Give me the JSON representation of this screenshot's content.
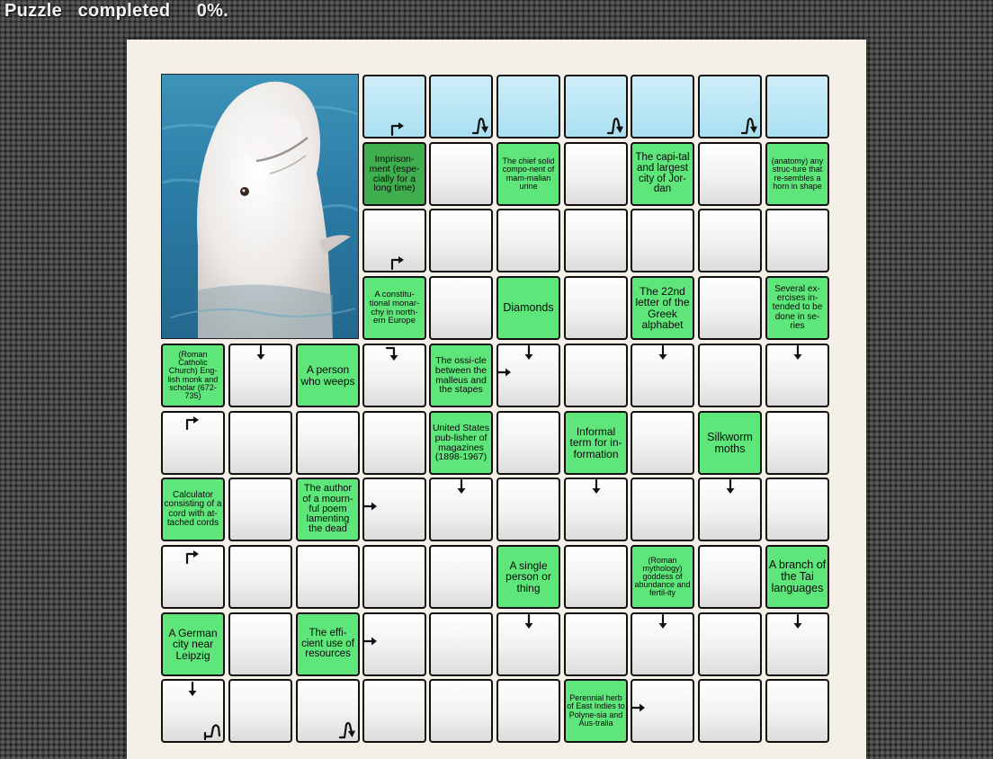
{
  "status": {
    "label": "Puzzle",
    "word": "completed",
    "percent": "0%."
  },
  "photo_icon": "beluga-whale-photo",
  "colors": {
    "clue": "#5fe67a",
    "clue_selected": "#3fae4e",
    "answer_row": "#a9dff0",
    "paper": "#f4f0e8"
  },
  "grid": {
    "answer_row": [
      {
        "arrow": "corner-right"
      },
      {
        "arrow": "snake-down"
      },
      {
        "arrow": ""
      },
      {
        "arrow": "snake-down"
      },
      {
        "arrow": ""
      },
      {
        "arrow": "snake-down"
      },
      {
        "arrow": ""
      }
    ],
    "clues": [
      {
        "text": "Imprison-ment (espe-cially for a long time)",
        "selected": true
      },
      {
        "text": "The chief solid compo-nent of mam-malian urine"
      },
      {
        "text": "The capi-tal and largest city of Jor-dan"
      },
      {
        "text": "(anatomy) any struc-ture that re-sembles a horn in shape"
      },
      {
        "text": "A constitu-tional monar-chy in north-ern Europe"
      },
      {
        "text": "Diamonds"
      },
      {
        "text": "The 22nd letter of the Greek alphabet"
      },
      {
        "text": "Several ex-ercises in-tended to be done in se-ries"
      },
      {
        "text": "(Roman Catholic Church) Eng-lish monk and scholar (672-735)"
      },
      {
        "text": "A person who weeps"
      },
      {
        "text": "The ossi-cle between the malleus and the stapes"
      },
      {
        "text": "United States pub-lisher of magazines (1898-1967)"
      },
      {
        "text": "Informal term for in-formation"
      },
      {
        "text": "Silkworm moths"
      },
      {
        "text": "Calculator consisting of a cord with at-tached cords"
      },
      {
        "text": "The author of a mourn-ful poem lamenting the dead"
      },
      {
        "text": "A single person or thing"
      },
      {
        "text": "(Roman mythology) goddess of abundance and fertil-ity"
      },
      {
        "text": "A branch of the Tai languages"
      },
      {
        "text": "A German city near Leipzig"
      },
      {
        "text": "The effi-cient use of resources"
      },
      {
        "text": "Perennial herb of East Indies to Polyne-sia and Aus-tralia"
      }
    ]
  }
}
